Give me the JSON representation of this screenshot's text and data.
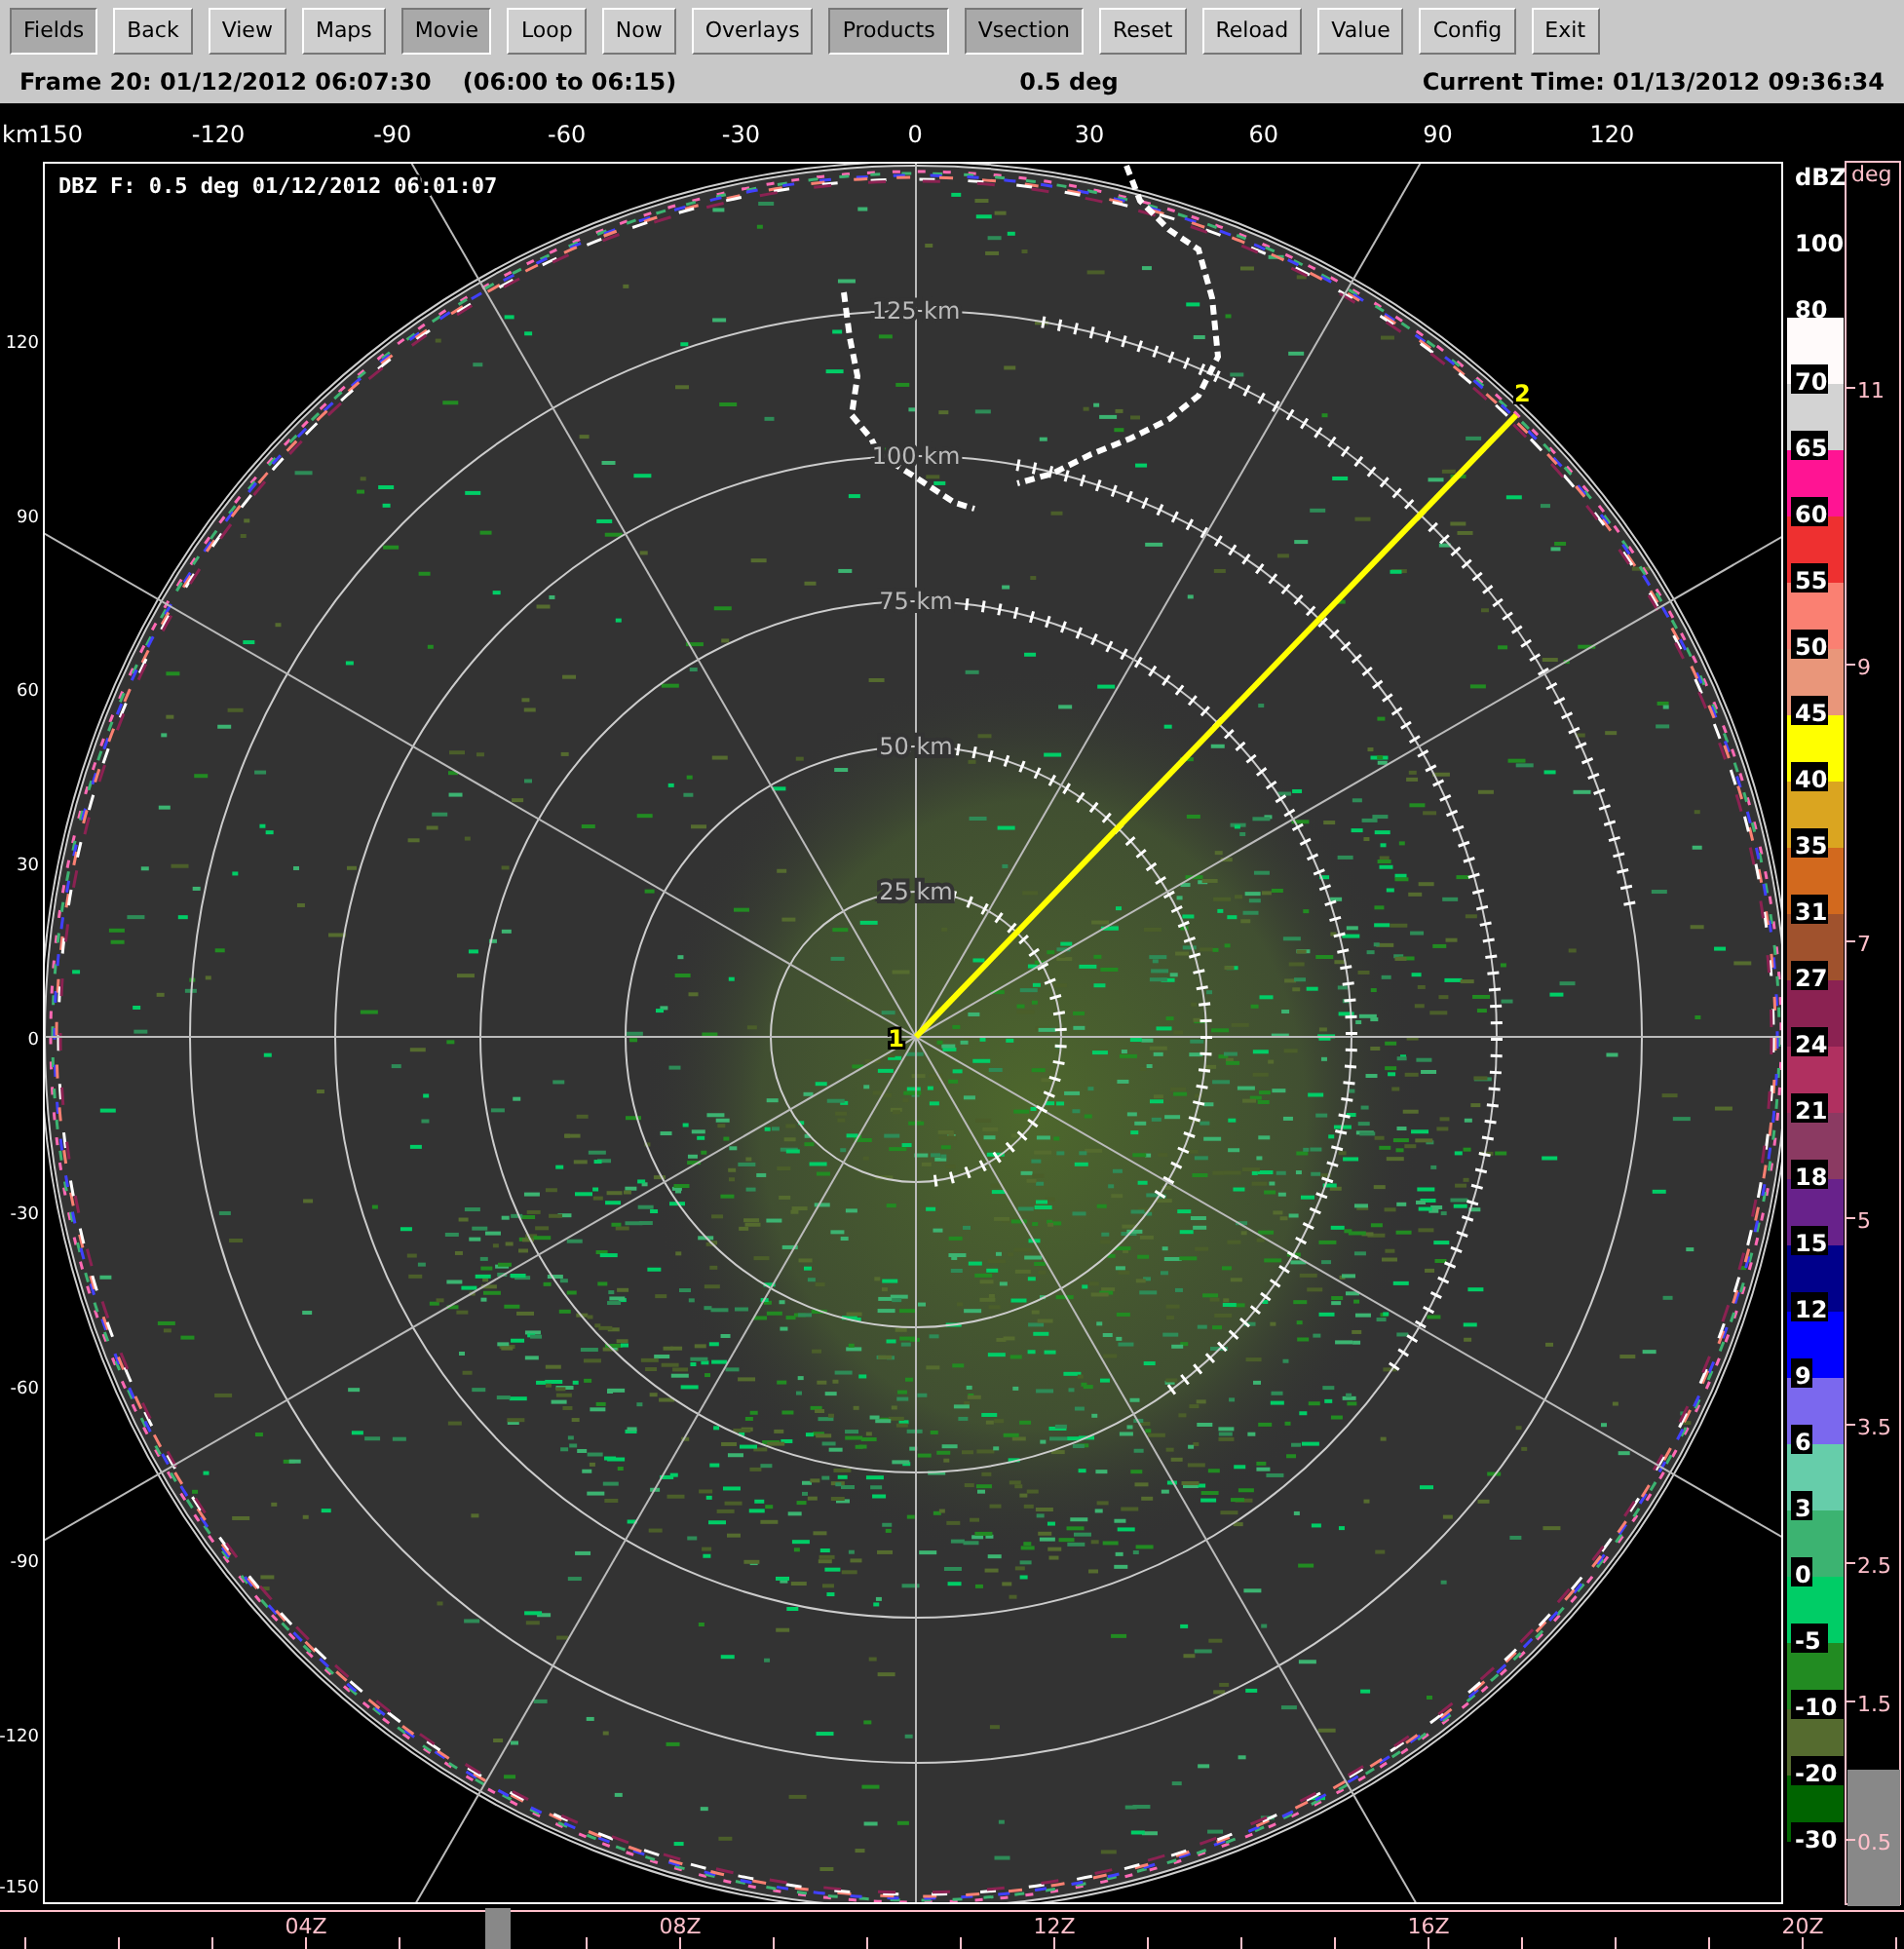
{
  "toolbar": [
    {
      "label": "Fields",
      "selected": true
    },
    {
      "label": "Back",
      "selected": false
    },
    {
      "label": "View",
      "selected": false
    },
    {
      "label": "Maps",
      "selected": false
    },
    {
      "label": "Movie",
      "selected": true
    },
    {
      "label": "Loop",
      "selected": false
    },
    {
      "label": "Now",
      "selected": false
    },
    {
      "label": "Overlays",
      "selected": false
    },
    {
      "label": "Products",
      "selected": true
    },
    {
      "label": "Vsection",
      "selected": true
    },
    {
      "label": "Reset",
      "selected": false
    },
    {
      "label": "Reload",
      "selected": false
    },
    {
      "label": "Value",
      "selected": false
    },
    {
      "label": "Config",
      "selected": false
    },
    {
      "label": "Exit",
      "selected": false
    }
  ],
  "status_bar": {
    "frame": "Frame 20: 01/12/2012 06:07:30",
    "range": "(06:00 to 06:15)",
    "elevation": "0.5 deg",
    "current_time": "Current Time: 01/13/2012 09:36:34"
  },
  "plot": {
    "title": "DBZ F: 0.5 deg 01/12/2012 06:01:07",
    "x_axis": {
      "unit_label": "km150",
      "ticks": [
        "-120",
        "-90",
        "-60",
        "-30",
        "0",
        "30",
        "60",
        "90",
        "120"
      ]
    },
    "y_axis": {
      "ticks": [
        "120",
        "90",
        "60",
        "30",
        "0",
        "-30",
        "-60",
        "-90",
        "-120",
        "-150"
      ]
    },
    "range_rings": [
      "125 km",
      "100 km",
      "75 km",
      "50 km",
      "25 km"
    ],
    "cross_section_points": [
      "1",
      "2"
    ]
  },
  "color_scale": {
    "unit": "dBZ",
    "top_labels": [
      "100",
      "80"
    ],
    "bands": [
      {
        "label": "70",
        "color": "#fffafa"
      },
      {
        "label": "65",
        "color": "#d3d3d3"
      },
      {
        "label": "60",
        "color": "#ff1493"
      },
      {
        "label": "55",
        "color": "#ee3030"
      },
      {
        "label": "50",
        "color": "#fa8072"
      },
      {
        "label": "45",
        "color": "#e9967a"
      },
      {
        "label": "40",
        "color": "#ffff00"
      },
      {
        "label": "35",
        "color": "#daa520"
      },
      {
        "label": "31",
        "color": "#d2691e"
      },
      {
        "label": "27",
        "color": "#a0522d"
      },
      {
        "label": "24",
        "color": "#8b2252"
      },
      {
        "label": "21",
        "color": "#b03060"
      },
      {
        "label": "18",
        "color": "#8b3a62"
      },
      {
        "label": "15",
        "color": "#68228b"
      },
      {
        "label": "12",
        "color": "#00008b"
      },
      {
        "label": "9",
        "color": "#0000ff"
      },
      {
        "label": "6",
        "color": "#7b68ee"
      },
      {
        "label": "3",
        "color": "#66cdaa"
      },
      {
        "label": "0",
        "color": "#3cb371"
      },
      {
        "label": "-5",
        "color": "#00cd66"
      },
      {
        "label": "-10",
        "color": "#228b22"
      },
      {
        "label": "-20",
        "color": "#556b2f"
      },
      {
        "label": "-30",
        "color": "#006400"
      }
    ]
  },
  "elevations": {
    "header": "deg",
    "items": [
      {
        "label": "11",
        "selected": false
      },
      {
        "label": "9",
        "selected": false
      },
      {
        "label": "7",
        "selected": false
      },
      {
        "label": "5",
        "selected": false
      },
      {
        "label": "3.5",
        "selected": false
      },
      {
        "label": "2.5",
        "selected": false
      },
      {
        "label": "1.5",
        "selected": false
      },
      {
        "label": "0.5",
        "selected": true
      }
    ]
  },
  "time_axis": {
    "labels": [
      "04Z",
      "08Z",
      "12Z",
      "16Z",
      "20Z"
    ]
  }
}
